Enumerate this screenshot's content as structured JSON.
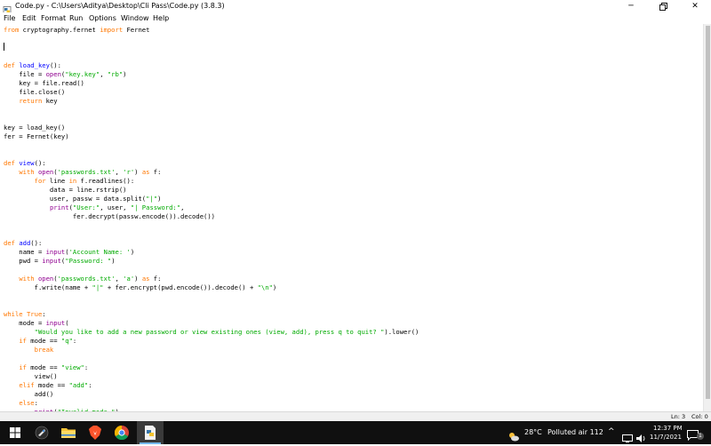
{
  "window": {
    "title": "Code.py - C:\\Users\\Aditya\\Desktop\\Cli Pass\\Code.py (3.8.3)"
  },
  "menu": [
    "File",
    "Edit",
    "Format",
    "Run",
    "Options",
    "Window",
    "Help"
  ],
  "status": {
    "line": "Ln: 3",
    "col": "Col: 0"
  },
  "taskbar": {
    "weather_temp": "28°C",
    "weather_text": "Polluted air 112",
    "time": "12:37 PM",
    "date": "11/7/2021",
    "notification_count": "1"
  },
  "code": [
    [
      [
        "kw",
        "from"
      ],
      [
        "n",
        " cryptography.fernet "
      ],
      [
        "kw",
        "import"
      ],
      [
        "n",
        " Fernet"
      ]
    ],
    [],
    [],
    [],
    [
      [
        "kw",
        "def"
      ],
      [
        "n",
        " "
      ],
      [
        "df",
        "load_key"
      ],
      [
        "n",
        "():"
      ]
    ],
    [
      [
        "n",
        "    file = "
      ],
      [
        "bi",
        "open"
      ],
      [
        "n",
        "("
      ],
      [
        "st",
        "\"key.key\""
      ],
      [
        "n",
        ", "
      ],
      [
        "st",
        "\"rb\""
      ],
      [
        "n",
        ")"
      ]
    ],
    [
      [
        "n",
        "    key = file.read()"
      ]
    ],
    [
      [
        "n",
        "    file.close()"
      ]
    ],
    [
      [
        "n",
        "    "
      ],
      [
        "kw",
        "return"
      ],
      [
        "n",
        " key"
      ]
    ],
    [],
    [],
    [
      [
        "n",
        "key = load_key()"
      ]
    ],
    [
      [
        "n",
        "fer = Fernet(key)"
      ]
    ],
    [],
    [],
    [
      [
        "kw",
        "def"
      ],
      [
        "n",
        " "
      ],
      [
        "df",
        "view"
      ],
      [
        "n",
        "():"
      ]
    ],
    [
      [
        "n",
        "    "
      ],
      [
        "kw",
        "with"
      ],
      [
        "n",
        " "
      ],
      [
        "bi",
        "open"
      ],
      [
        "n",
        "("
      ],
      [
        "st",
        "'passwords.txt'"
      ],
      [
        "n",
        ", "
      ],
      [
        "st",
        "'r'"
      ],
      [
        "n",
        ") "
      ],
      [
        "kw",
        "as"
      ],
      [
        "n",
        " f:"
      ]
    ],
    [
      [
        "n",
        "        "
      ],
      [
        "kw",
        "for"
      ],
      [
        "n",
        " line "
      ],
      [
        "kw",
        "in"
      ],
      [
        "n",
        " f.readlines():"
      ]
    ],
    [
      [
        "n",
        "            data = line.rstrip()"
      ]
    ],
    [
      [
        "n",
        "            user, passw = data.split("
      ],
      [
        "st",
        "\"|\""
      ],
      [
        "n",
        ")"
      ]
    ],
    [
      [
        "n",
        "            "
      ],
      [
        "bi",
        "print"
      ],
      [
        "n",
        "("
      ],
      [
        "st",
        "\"User:\""
      ],
      [
        "n",
        ", user, "
      ],
      [
        "st",
        "\"| Password:\""
      ],
      [
        "n",
        ","
      ]
    ],
    [
      [
        "n",
        "                  fer.decrypt(passw.encode()).decode())"
      ]
    ],
    [],
    [],
    [
      [
        "kw",
        "def"
      ],
      [
        "n",
        " "
      ],
      [
        "df",
        "add"
      ],
      [
        "n",
        "():"
      ]
    ],
    [
      [
        "n",
        "    name = "
      ],
      [
        "bi",
        "input"
      ],
      [
        "n",
        "("
      ],
      [
        "st",
        "'Account Name: '"
      ],
      [
        "n",
        ")"
      ]
    ],
    [
      [
        "n",
        "    pwd = "
      ],
      [
        "bi",
        "input"
      ],
      [
        "n",
        "("
      ],
      [
        "st",
        "\"Password: \""
      ],
      [
        "n",
        ")"
      ]
    ],
    [],
    [
      [
        "n",
        "    "
      ],
      [
        "kw",
        "with"
      ],
      [
        "n",
        " "
      ],
      [
        "bi",
        "open"
      ],
      [
        "n",
        "("
      ],
      [
        "st",
        "'passwords.txt'"
      ],
      [
        "n",
        ", "
      ],
      [
        "st",
        "'a'"
      ],
      [
        "n",
        ") "
      ],
      [
        "kw",
        "as"
      ],
      [
        "n",
        " f:"
      ]
    ],
    [
      [
        "n",
        "        f.write(name + "
      ],
      [
        "st",
        "\"|\""
      ],
      [
        "n",
        " + fer.encrypt(pwd.encode()).decode() + "
      ],
      [
        "st",
        "\"\\n\""
      ],
      [
        "n",
        ")"
      ]
    ],
    [],
    [],
    [
      [
        "kw",
        "while"
      ],
      [
        "n",
        " "
      ],
      [
        "kw",
        "True"
      ],
      [
        "n",
        ":"
      ]
    ],
    [
      [
        "n",
        "    mode = "
      ],
      [
        "bi",
        "input"
      ],
      [
        "n",
        "("
      ]
    ],
    [
      [
        "n",
        "        "
      ],
      [
        "st",
        "\"Would you like to add a new password or view existing ones (view, add), press q to quit? \""
      ],
      [
        "n",
        ").lower()"
      ]
    ],
    [
      [
        "n",
        "    "
      ],
      [
        "kw",
        "if"
      ],
      [
        "n",
        " mode == "
      ],
      [
        "st",
        "\"q\""
      ],
      [
        "n",
        ":"
      ]
    ],
    [
      [
        "n",
        "        "
      ],
      [
        "kw",
        "break"
      ]
    ],
    [],
    [
      [
        "n",
        "    "
      ],
      [
        "kw",
        "if"
      ],
      [
        "n",
        " mode == "
      ],
      [
        "st",
        "\"view\""
      ],
      [
        "n",
        ":"
      ]
    ],
    [
      [
        "n",
        "        view()"
      ]
    ],
    [
      [
        "n",
        "    "
      ],
      [
        "kw",
        "elif"
      ],
      [
        "n",
        " mode == "
      ],
      [
        "st",
        "\"add\""
      ],
      [
        "n",
        ":"
      ]
    ],
    [
      [
        "n",
        "        add()"
      ]
    ],
    [
      [
        "n",
        "    "
      ],
      [
        "kw",
        "else"
      ],
      [
        "n",
        ":"
      ]
    ],
    [
      [
        "n",
        "        "
      ],
      [
        "bi",
        "print"
      ],
      [
        "n",
        "("
      ],
      [
        "st",
        "\"Invalid mode.\""
      ],
      [
        "n",
        ")"
      ]
    ]
  ]
}
